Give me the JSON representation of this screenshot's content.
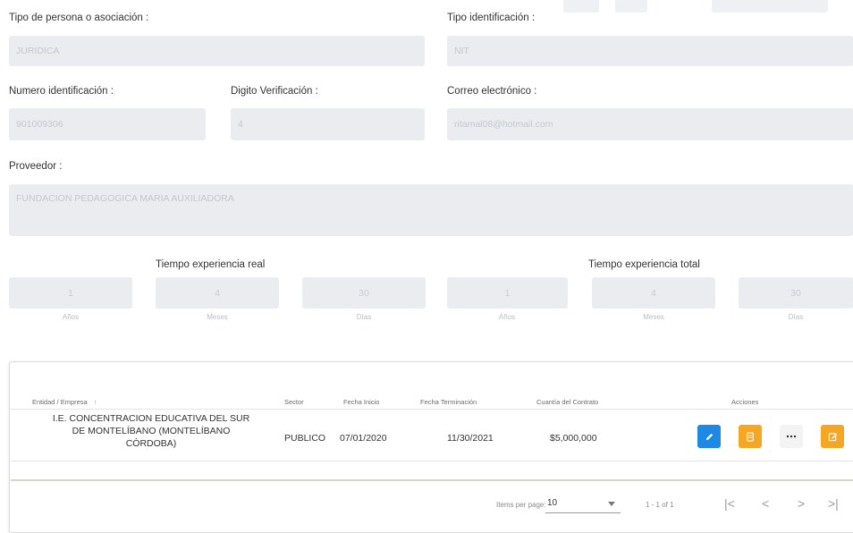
{
  "form": {
    "tipo_persona": {
      "label": "Tipo de persona o asociación :",
      "value": "JURIDICA"
    },
    "tipo_identificacion": {
      "label": "Tipo identificación :",
      "value": "NIT"
    },
    "numero_identificacion": {
      "label": "Numero identificación :",
      "value": "901009306"
    },
    "digito_verificacion": {
      "label": "Digito Verificación :",
      "value": "4"
    },
    "correo": {
      "label": "Correo electrónico :",
      "value": "ritamal08@hotmail.com"
    },
    "proveedor": {
      "label": "Proveedor :",
      "value": "FUNDACION PEDAGOGICA MARIA AUXILIADORA"
    }
  },
  "experience": {
    "real": {
      "title": "Tiempo experiencia real",
      "years": "1",
      "months": "4",
      "days": "30"
    },
    "total": {
      "title": "Tiempo experiencia total",
      "years": "1",
      "months": "4",
      "days": "30"
    },
    "captions": {
      "years": "Años",
      "months": "Meses",
      "days": "Días"
    }
  },
  "table": {
    "headers": {
      "entidad": "Entidad / Empresa",
      "sort_icon": "↑",
      "sector": "Sector",
      "fecha_inicio": "Fecha Inicio",
      "fecha_terminacion": "Fecha Terminación",
      "cuantia": "Cuantía del Contrato",
      "acciones": "Acciones"
    },
    "rows": [
      {
        "entidad_line1": "I.E. CONCENTRACION EDUCATIVA DEL SUR",
        "entidad_line2": "DE MONTELÍBANO (MONTELÍBANO",
        "entidad_line3": "CÓRDOBA)",
        "sector": "PUBLICO",
        "fecha_inicio": "07/01/2020",
        "fecha_terminacion": "11/30/2021",
        "cuantia": "$5,000,000"
      }
    ],
    "action_icons": [
      "edit-icon",
      "document-icon",
      "more-icon",
      "note-icon"
    ],
    "colors": {
      "edit": "#1e88e5",
      "amber": "#f5a623",
      "more_bg": "#f3f3f3"
    }
  },
  "pagination": {
    "items_per_page_label": "Items per page:",
    "items_per_page_value": "10",
    "range": "1 - 1 of 1"
  }
}
